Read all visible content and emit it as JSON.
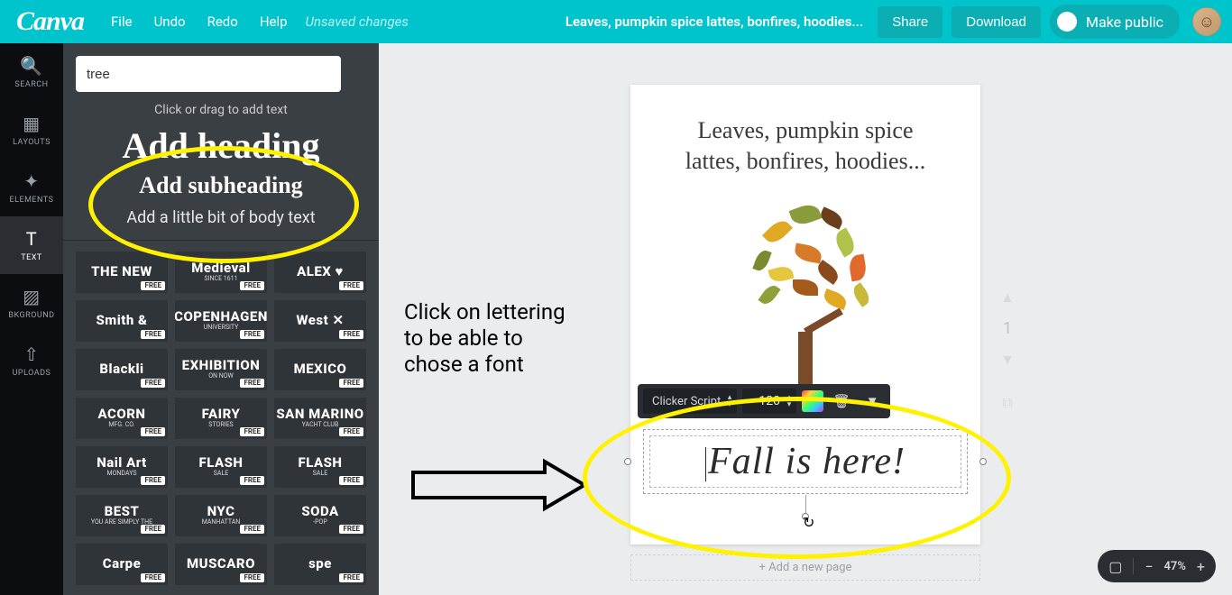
{
  "topbar": {
    "logo": "Canva",
    "menu": {
      "file": "File",
      "undo": "Undo",
      "redo": "Redo",
      "help": "Help"
    },
    "unsaved": "Unsaved changes",
    "doc_title": "Leaves, pumpkin spice lattes, bonfires, hoodies...",
    "share": "Share",
    "download": "Download",
    "make_public": "Make public"
  },
  "leftnav": {
    "search": "SEARCH",
    "layouts": "LAYOUTS",
    "elements": "ELEMENTS",
    "text": "TEXT",
    "bkground": "BKGROUND",
    "uploads": "UPLOADS"
  },
  "panel": {
    "search_value": "tree",
    "hint": "Click or drag to add text",
    "add_heading": "Add heading",
    "add_subheading": "Add subheading",
    "add_body": "Add a little bit of body text",
    "free": "FREE",
    "templates": [
      {
        "line1": "THE NEW",
        "line2": ""
      },
      {
        "line1": "Medieval",
        "line2": "SINCE 1611"
      },
      {
        "line1": "ALEX ♥",
        "line2": ""
      },
      {
        "line1": "Smith &",
        "line2": ""
      },
      {
        "line1": "COPENHAGEN",
        "line2": "UNIVERSITY"
      },
      {
        "line1": "West ✕",
        "line2": ""
      },
      {
        "line1": "Blackli",
        "line2": ""
      },
      {
        "line1": "EXHIBITION",
        "line2": "ON NOW"
      },
      {
        "line1": "MEXICO",
        "line2": ""
      },
      {
        "line1": "ACORN",
        "line2": "MFG. CO."
      },
      {
        "line1": "FAIRY",
        "line2": "STORIES"
      },
      {
        "line1": "SAN MARINO",
        "line2": "YACHT CLUB"
      },
      {
        "line1": "Nail Art",
        "line2": "MONDAYS"
      },
      {
        "line1": "FLASH",
        "line2": "SALE"
      },
      {
        "line1": "FLASH",
        "line2": "SALE"
      },
      {
        "line1": "BEST",
        "line2": "YOU ARE SIMPLY THE"
      },
      {
        "line1": "NYC",
        "line2": "MANHATTAN"
      },
      {
        "line1": "SODA",
        "line2": "-POP"
      },
      {
        "line1": "Carpe",
        "line2": ""
      },
      {
        "line1": "MUSCARO",
        "line2": ""
      },
      {
        "line1": "spe",
        "line2": ""
      }
    ]
  },
  "annotation": {
    "text": "Click on lettering to be able to chose a font"
  },
  "canvas": {
    "heading_line1": "Leaves, pumpkin spice",
    "heading_line2": "lattes, bonfires, hoodies...",
    "selected_text": "Fall is here!",
    "add_page": "+ Add a new page",
    "page_no": "1"
  },
  "toolbar": {
    "font": "Clicker Script",
    "size": "120"
  },
  "zoom": {
    "pct": "47%"
  }
}
